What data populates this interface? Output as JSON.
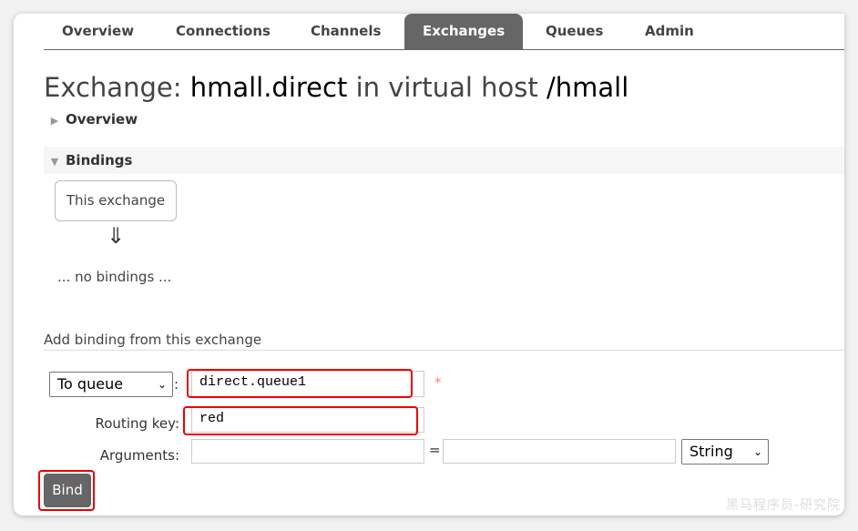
{
  "nav": {
    "tabs": [
      {
        "label": "Overview"
      },
      {
        "label": "Connections"
      },
      {
        "label": "Channels"
      },
      {
        "label": "Exchanges",
        "active": true
      },
      {
        "label": "Queues"
      },
      {
        "label": "Admin"
      }
    ]
  },
  "title": {
    "prefix": "Exchange:",
    "name": "hmall.direct",
    "middle": "in virtual host",
    "vhost": "/hmall"
  },
  "sections": {
    "overview": "Overview",
    "bindings": "Bindings"
  },
  "bindings": {
    "this_exchange": "This exchange",
    "arrow": "⇓",
    "empty": "... no bindings ..."
  },
  "add_binding": {
    "heading": "Add binding from this exchange",
    "destination_type": "To queue",
    "destination_value": "direct.queue1",
    "required_mark": "*",
    "routing_key_label": "Routing key:",
    "routing_key_value": "red",
    "arguments_label": "Arguments:",
    "arguments_key": "",
    "equals": "=",
    "arguments_value": "",
    "arguments_type": "String",
    "bind_label": "Bind"
  },
  "highlight_color": "#e00000",
  "watermark": "黑马程序员-研究院"
}
